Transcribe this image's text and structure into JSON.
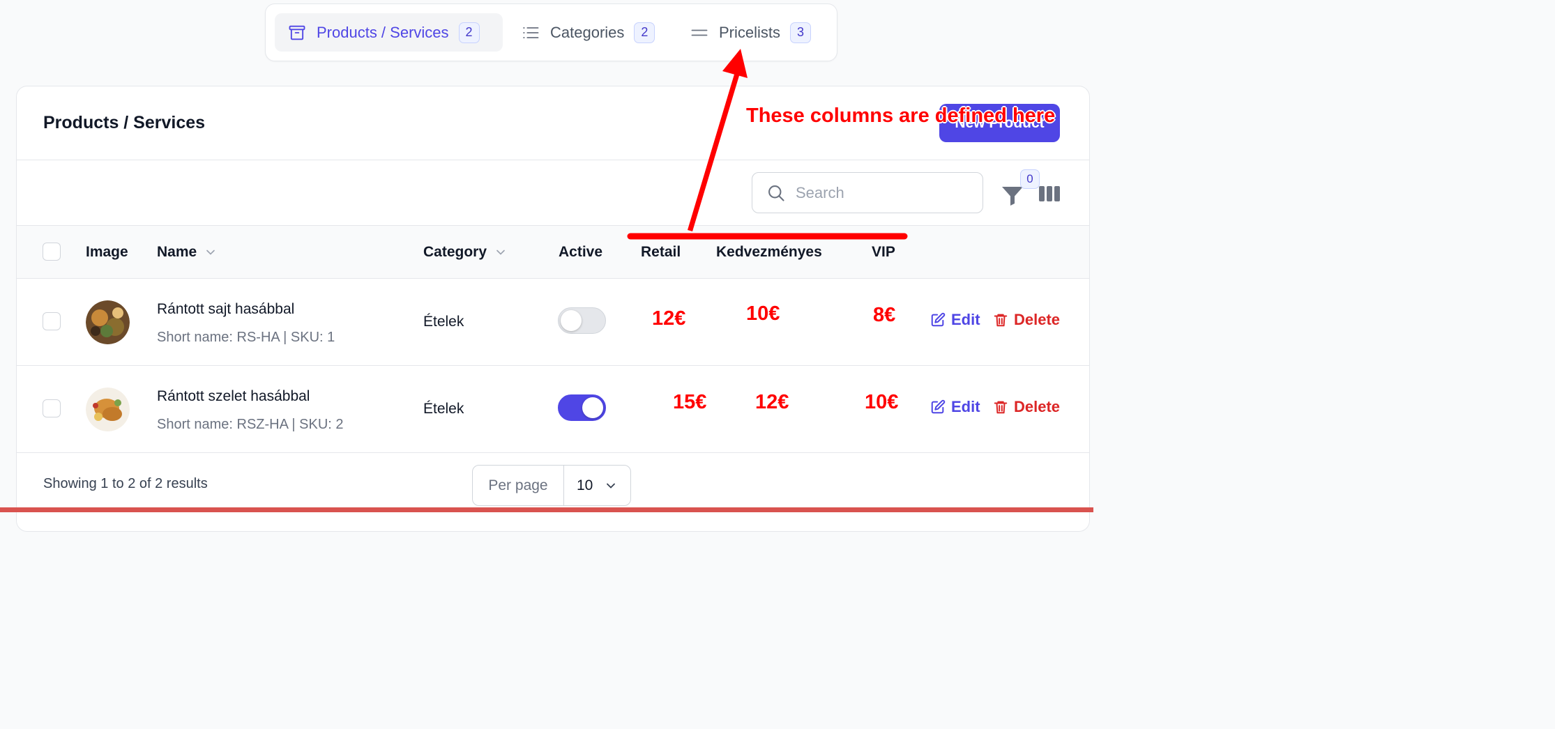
{
  "tabs": [
    {
      "label": "Products / Services",
      "count": "2",
      "icon": "archive-box-icon"
    },
    {
      "label": "Categories",
      "count": "2",
      "icon": "list-icon"
    },
    {
      "label": "Pricelists",
      "count": "3",
      "icon": "equals-lines-icon"
    }
  ],
  "card": {
    "title": "Products / Services",
    "new_button_label": "New Product"
  },
  "toolbar": {
    "search_placeholder": "Search",
    "filter_count": "0"
  },
  "table": {
    "headers": {
      "image": "Image",
      "name": "Name",
      "category": "Category",
      "active": "Active",
      "retail": "Retail",
      "kedvezmenyes": "Kedvezményes",
      "vip": "VIP"
    },
    "rows": [
      {
        "name": "Rántott sajt hasábbal",
        "subtitle": "Short name: RS-HA | SKU: 1",
        "category": "Ételek",
        "active": false,
        "retail": "12€",
        "kedvezmenyes": "10€",
        "vip": "8€",
        "edit_label": "Edit",
        "delete_label": "Delete"
      },
      {
        "name": "Rántott szelet hasábbal",
        "subtitle": "Short name: RSZ-HA | SKU: 2",
        "category": "Ételek",
        "active": true,
        "retail": "15€",
        "kedvezmenyes": "12€",
        "vip": "10€",
        "edit_label": "Edit",
        "delete_label": "Delete"
      }
    ]
  },
  "footer": {
    "showing_text": "Showing 1 to 2 of 2 results",
    "per_page_label": "Per page",
    "per_page_value": "10"
  },
  "annotation": {
    "text": "These columns are defined here",
    "color": "#ff0000"
  },
  "colors": {
    "accent": "#4f46e5",
    "danger": "#dc2626"
  }
}
